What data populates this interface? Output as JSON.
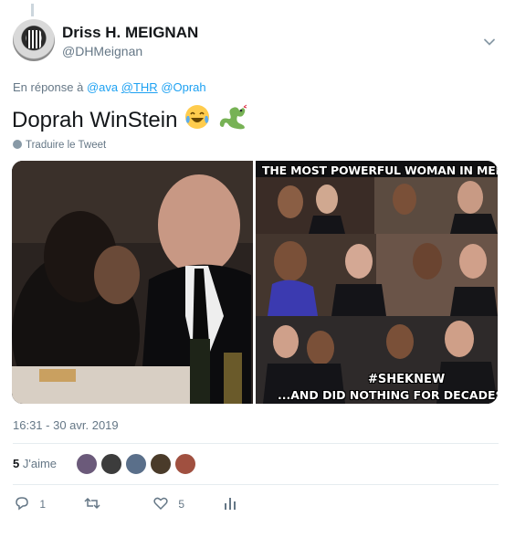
{
  "author": {
    "name": "Driss H. MEIGNAN",
    "handle": "@DHMeignan"
  },
  "reply": {
    "prefix": "En réponse à",
    "mentions": [
      "@ava",
      "@THR",
      "@Oprah"
    ]
  },
  "tweet": {
    "text": "Doprah WinStein",
    "emojis": [
      "face-with-tears-of-joy",
      "snake"
    ],
    "translate_label": "Traduire le Tweet"
  },
  "media": {
    "meme_top": "THE MOST POWERFUL WOMAN IN MEDIA",
    "meme_hashtag": "#SHEKNEW",
    "meme_bottom": "...AND DID NOTHING FOR DECADES"
  },
  "timestamp": "16:31 - 30 avr. 2019",
  "likes": {
    "count": "5",
    "label": "J'aime",
    "avatar_colors": [
      "#6b5a7a",
      "#3c3c3c",
      "#5a6f8a",
      "#4a3b2a",
      "#a05040"
    ]
  },
  "actions": {
    "reply_count": "1",
    "retweet_count": "",
    "like_count": "5"
  },
  "colors": {
    "link": "#1da1f2",
    "secondary": "#657786",
    "primary": "#14171a"
  }
}
